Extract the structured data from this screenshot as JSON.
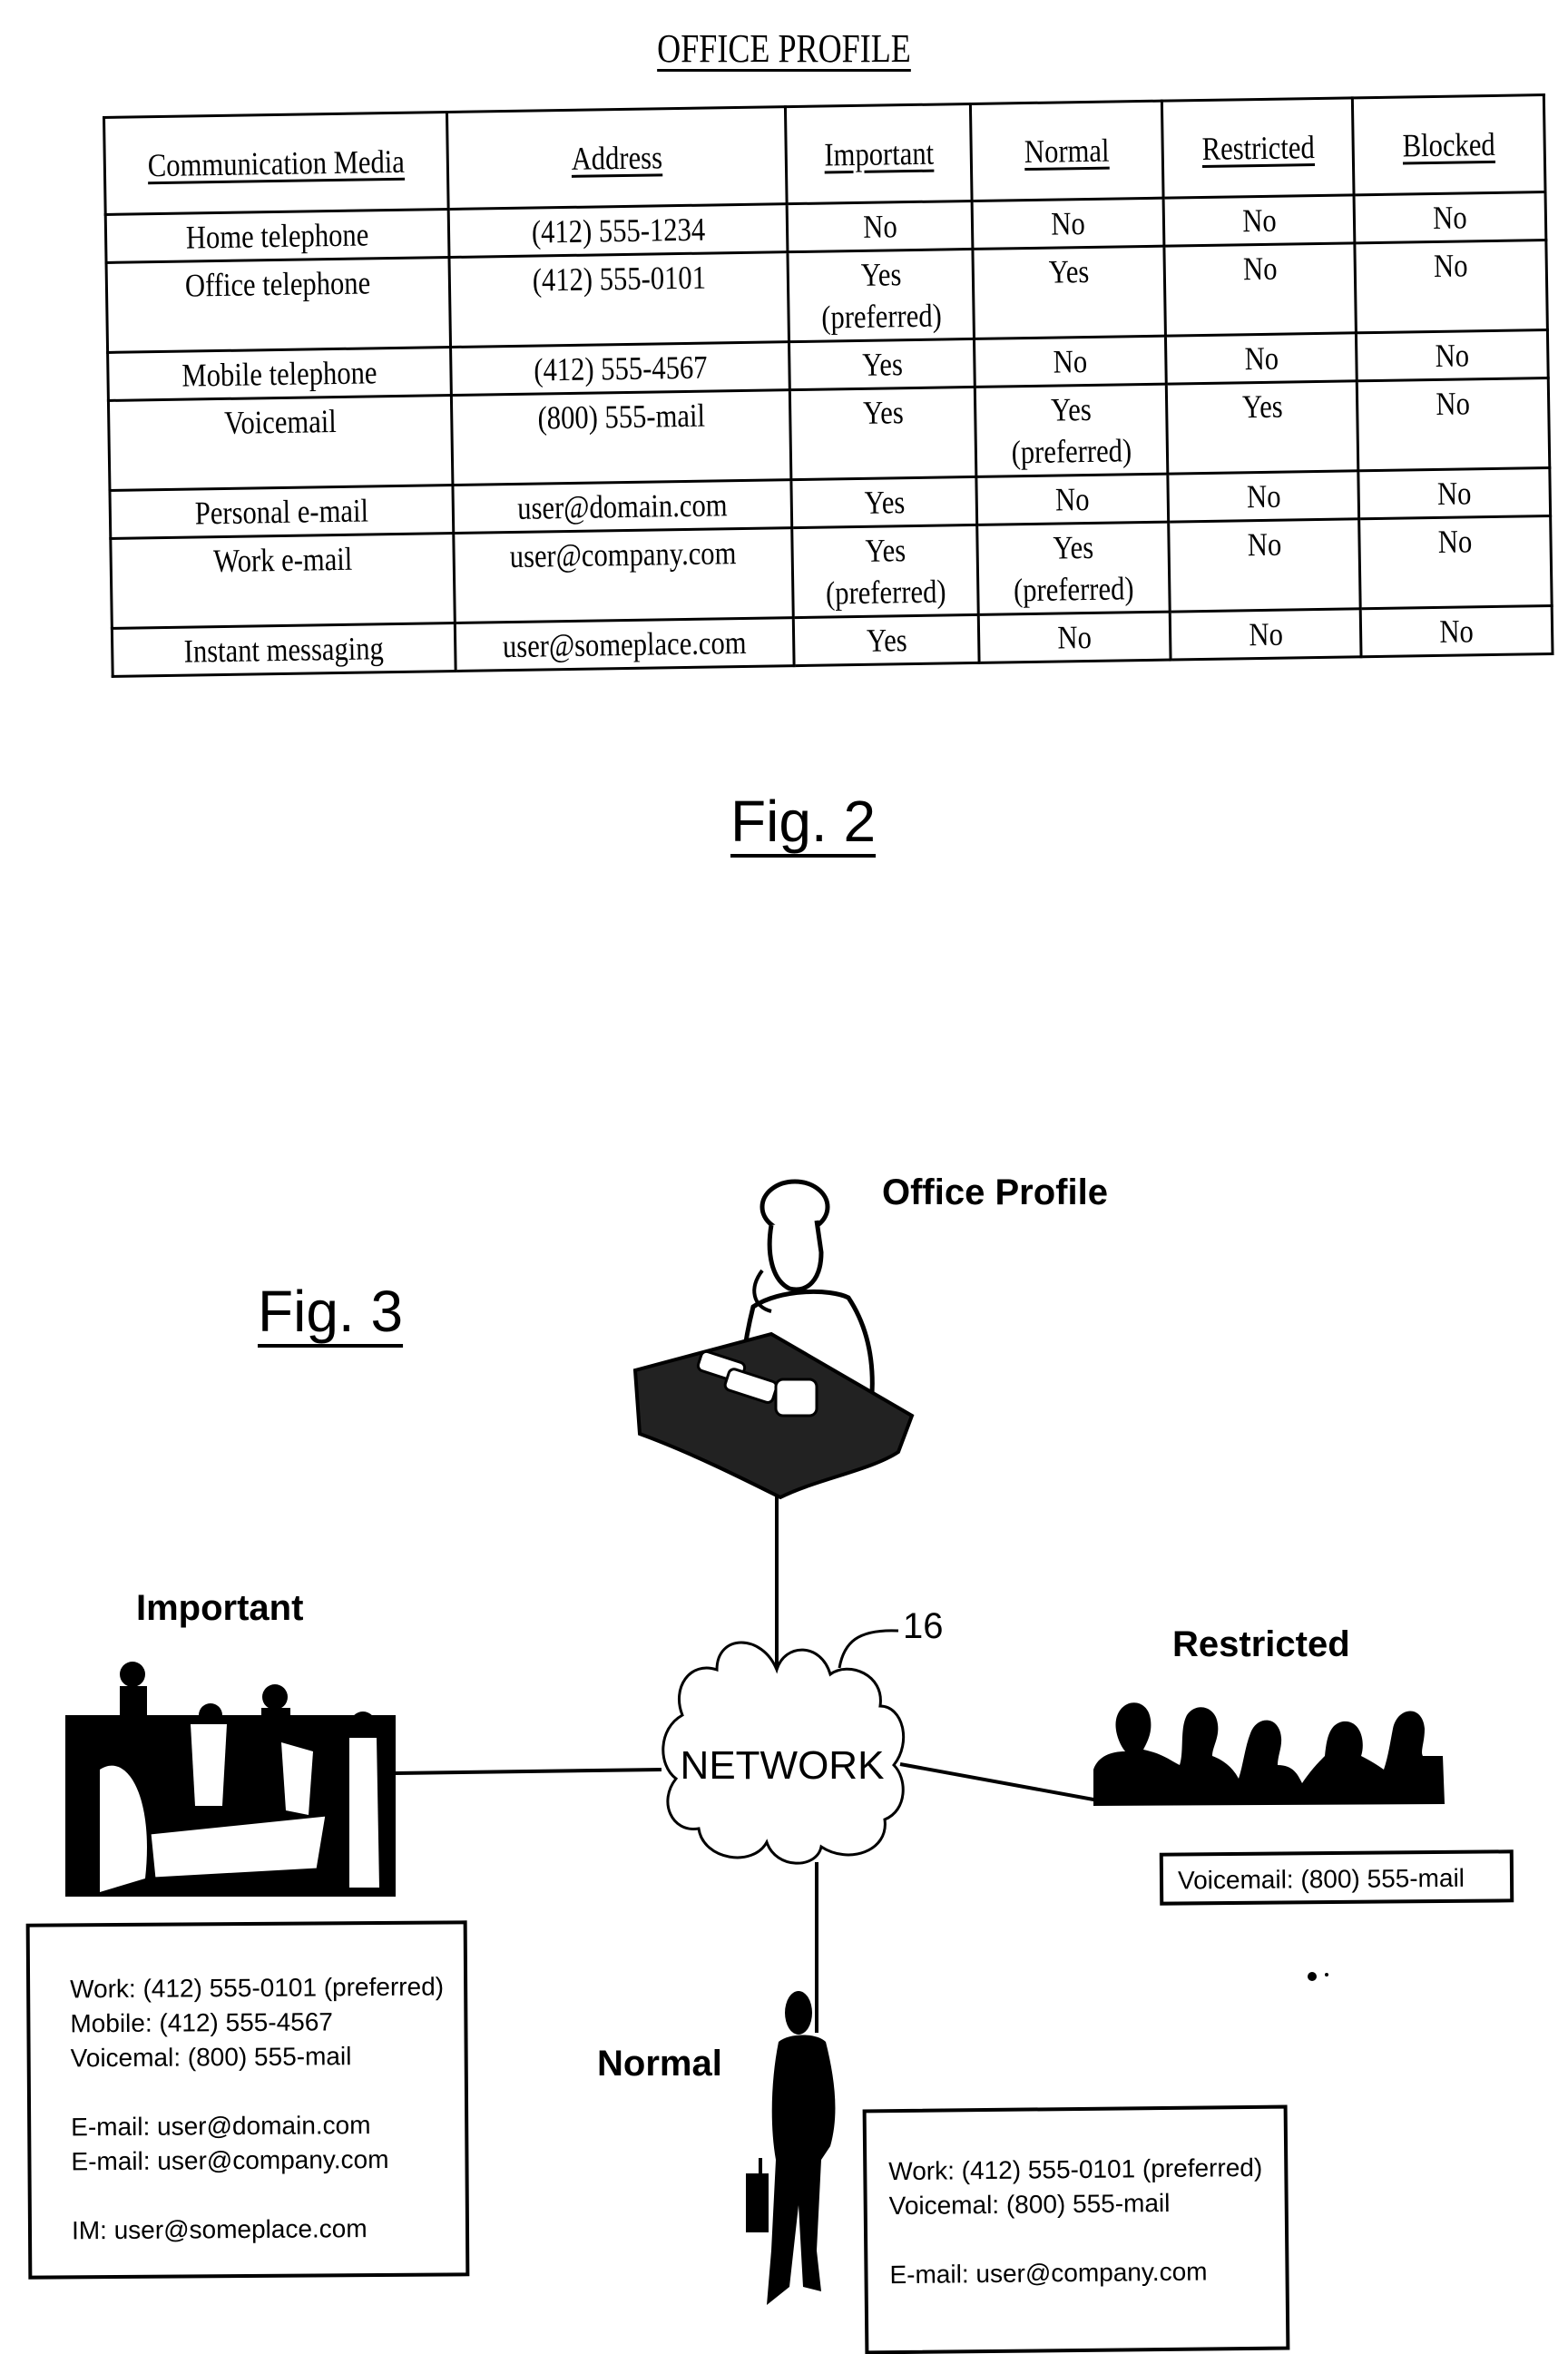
{
  "document": {
    "title": "OFFICE PROFILE",
    "fig2_label": "Fig. 2",
    "fig3_label": "Fig. 3"
  },
  "table": {
    "headers": [
      "Communication Media",
      "Address",
      "Important",
      "Normal",
      "Restricted",
      "Blocked"
    ],
    "rows": [
      {
        "media": "Home telephone",
        "address": "(412) 555-1234",
        "important": [
          "No"
        ],
        "normal": [
          "No"
        ],
        "restricted": [
          "No"
        ],
        "blocked": [
          "No"
        ]
      },
      {
        "media": "Office telephone",
        "address": "(412) 555-0101",
        "important": [
          "Yes",
          "(preferred)"
        ],
        "normal": [
          "Yes"
        ],
        "restricted": [
          "No"
        ],
        "blocked": [
          "No"
        ]
      },
      {
        "media": "Mobile telephone",
        "address": "(412) 555-4567",
        "important": [
          "Yes"
        ],
        "normal": [
          "No"
        ],
        "restricted": [
          "No"
        ],
        "blocked": [
          "No"
        ]
      },
      {
        "media": "Voicemail",
        "address": "(800) 555-mail",
        "important": [
          "Yes"
        ],
        "normal": [
          "Yes",
          "(preferred)"
        ],
        "restricted": [
          "Yes"
        ],
        "blocked": [
          "No"
        ]
      },
      {
        "media": "Personal e-mail",
        "address": "user@domain.com",
        "important": [
          "Yes"
        ],
        "normal": [
          "No"
        ],
        "restricted": [
          "No"
        ],
        "blocked": [
          "No"
        ]
      },
      {
        "media": "Work e-mail",
        "address": "user@company.com",
        "important": [
          "Yes",
          "(preferred)"
        ],
        "normal": [
          "Yes",
          "(preferred)"
        ],
        "restricted": [
          "No"
        ],
        "blocked": [
          "No"
        ]
      },
      {
        "media": "Instant messaging",
        "address": "user@someplace.com",
        "important": [
          "Yes"
        ],
        "normal": [
          "No"
        ],
        "restricted": [
          "No"
        ],
        "blocked": [
          "No"
        ]
      }
    ]
  },
  "diagram": {
    "network_label": "NETWORK",
    "network_ref": "16",
    "nodes": {
      "office": {
        "label": "Office Profile",
        "icon": "person-at-desk-with-phone-icon"
      },
      "important": {
        "label": "Important",
        "icon": "meeting-group-icon",
        "card": [
          "Work: (412) 555-0101 (preferred)",
          "Mobile: (412) 555-4567",
          "Voicemal: (800) 555-mail",
          "",
          "E-mail: user@domain.com",
          "E-mail: user@company.com",
          "",
          "IM: user@someplace.com"
        ]
      },
      "restricted": {
        "label": "Restricted",
        "icon": "audience-silhouettes-icon",
        "card": [
          "Voicemail: (800) 555-mail"
        ]
      },
      "normal": {
        "label": "Normal",
        "icon": "businessman-with-briefcase-icon",
        "card": [
          "Work: (412) 555-0101 (preferred)",
          "Voicemal: (800) 555-mail",
          "",
          "E-mail: user@company.com"
        ]
      }
    }
  }
}
